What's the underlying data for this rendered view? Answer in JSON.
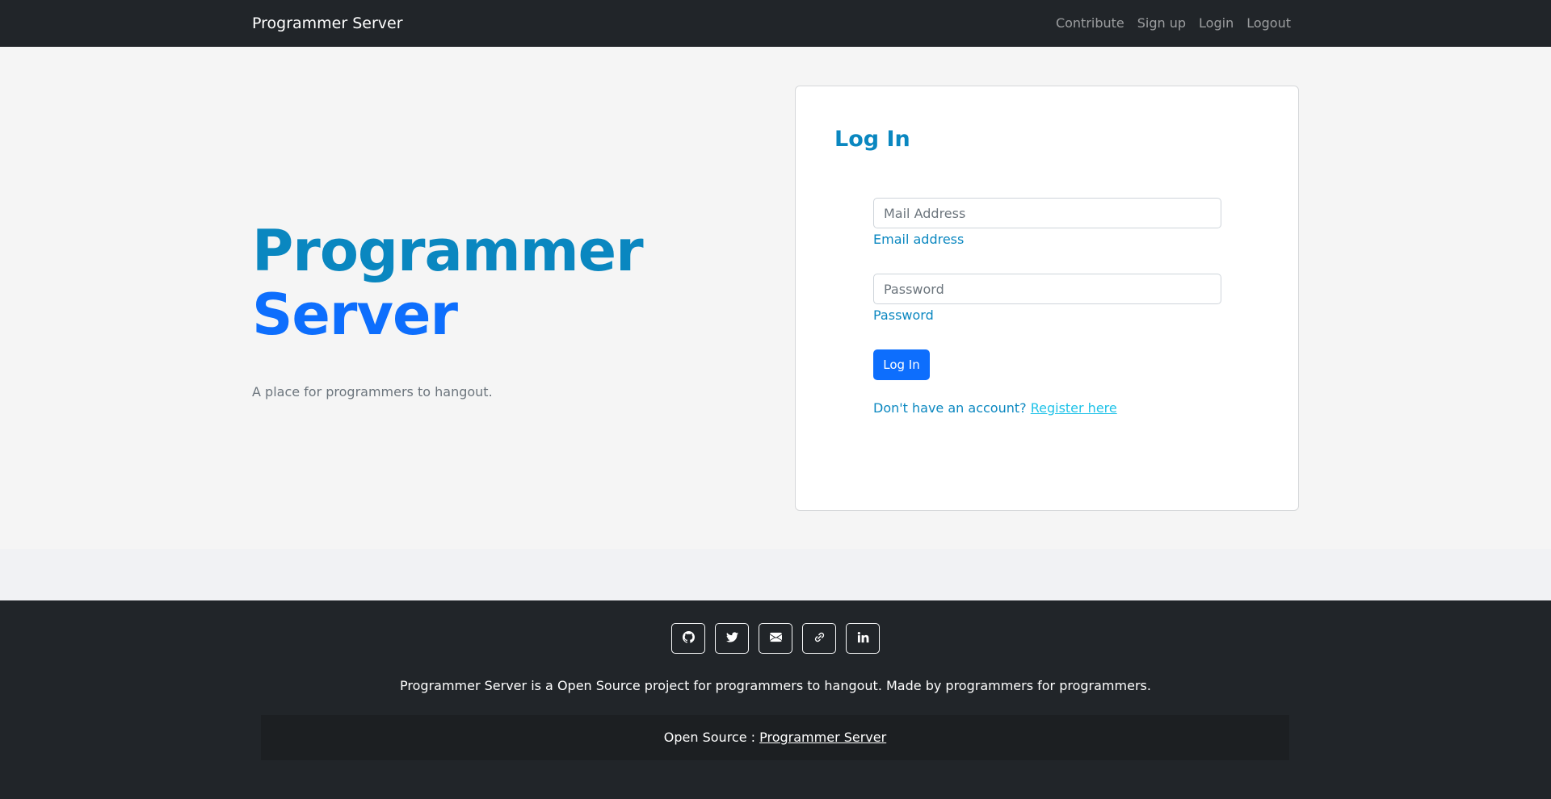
{
  "nav": {
    "brand": "Programmer Server",
    "links": [
      "Contribute",
      "Sign up",
      "Login",
      "Logout"
    ]
  },
  "hero": {
    "title_line1": "Programmer",
    "title_line2": "Server",
    "subtitle": "A place for programmers to hangout."
  },
  "login": {
    "title": "Log In",
    "email_placeholder": "Mail Address",
    "email_label": "Email address",
    "password_placeholder": "Password",
    "password_label": "Password",
    "button": "Log In",
    "no_account": "Don't have an account?",
    "register_link": "Register here"
  },
  "footer": {
    "social_icons": [
      "github-icon",
      "twitter-icon",
      "envelope-icon",
      "link-icon",
      "linkedin-icon"
    ],
    "description": "Programmer Server is a Open Source project for programmers to hangout. Made by programmers for programmers.",
    "open_source_prefix": "Open Source :",
    "open_source_link": "Programmer Server"
  },
  "colors": {
    "accent": "#0a87c0",
    "primary": "#0d6efd",
    "navbar": "#212529",
    "link_light": "#1ec2e8"
  }
}
